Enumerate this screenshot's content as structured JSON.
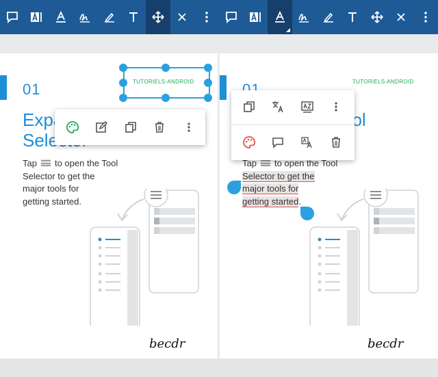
{
  "toolbar": {
    "left": [
      {
        "name": "comment-tool",
        "icon": "speech-bubble-icon",
        "active": false
      },
      {
        "name": "text-box-tool",
        "icon": "text-box-icon",
        "active": false
      },
      {
        "name": "underline-tool",
        "icon": "underline-text-icon",
        "active": false
      },
      {
        "name": "signature-tool",
        "icon": "signature-icon",
        "active": false
      },
      {
        "name": "pen-tool",
        "icon": "pen-icon",
        "active": false
      },
      {
        "name": "text-tool",
        "icon": "text-t-icon",
        "active": false
      },
      {
        "name": "move-tool",
        "icon": "move-arrows-icon",
        "active": true
      },
      {
        "name": "close-tool",
        "icon": "close-icon",
        "active": false
      },
      {
        "name": "more-menu",
        "icon": "more-vertical-icon",
        "active": false
      }
    ],
    "right": [
      {
        "name": "comment-tool",
        "icon": "speech-bubble-icon",
        "active": false
      },
      {
        "name": "text-box-tool",
        "icon": "text-box-icon",
        "active": false
      },
      {
        "name": "underline-tool",
        "icon": "underline-text-icon",
        "active": true
      },
      {
        "name": "signature-tool",
        "icon": "signature-icon",
        "active": false
      },
      {
        "name": "pen-tool",
        "icon": "pen-icon",
        "active": false
      },
      {
        "name": "text-tool",
        "icon": "text-t-icon",
        "active": false
      },
      {
        "name": "move-tool",
        "icon": "move-arrows-icon",
        "active": false
      },
      {
        "name": "close-tool",
        "icon": "close-icon",
        "active": false
      },
      {
        "name": "more-menu",
        "icon": "more-vertical-icon",
        "active": false
      }
    ]
  },
  "left_page": {
    "number": "01",
    "title_line1": "Expa",
    "title_line2": "Selector",
    "brand": "TUTORIELS-ANDROID",
    "body_before": "Tap",
    "body_after": "to open the Tool",
    "body_line2": "Selector to get the",
    "body_line3": "major tools for",
    "body_line4": "getting started.",
    "signature": "becdr",
    "popup_icons": [
      "palette-icon",
      "edit-icon",
      "copy-icon",
      "delete-icon",
      "more-vertical-icon"
    ]
  },
  "right_page": {
    "number": "01",
    "title_part": "Tool",
    "brand": "TUTORIELS-ANDROID",
    "body_before": "Tap",
    "body_after": "to open the Tool",
    "body_line2": "Selector to get the",
    "body_line3": "major tools for",
    "body_line4": "getting started",
    "body_period": ".",
    "signature": "becdr",
    "popup_row1_icons": [
      "copy-icon",
      "translate-icon",
      "define-icon",
      "more-vertical-icon"
    ],
    "popup_row2_icons": [
      "palette-icon",
      "comment-icon",
      "text-style-icon",
      "delete-icon"
    ]
  },
  "colors": {
    "toolbar": "#1e5b96",
    "toolbar_active": "#173f6b",
    "accent": "#1d8fd6",
    "brand": "#22a85a",
    "palette_green": "#22a85a",
    "palette_red": "#d9534f"
  }
}
